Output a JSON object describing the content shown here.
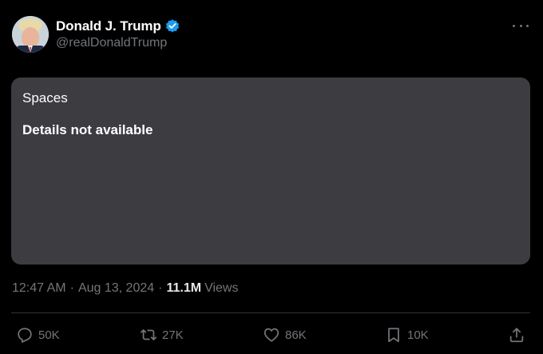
{
  "author": {
    "display_name": "Donald J. Trump",
    "handle": "@realDonaldTrump",
    "verified": true,
    "verified_color": "#1d9bf0"
  },
  "card": {
    "label": "Spaces",
    "details": "Details not available",
    "background": "#3d3c41"
  },
  "meta": {
    "time": "12:47 AM",
    "separator": "·",
    "date": "Aug 13, 2024",
    "views_count": "11.1M",
    "views_label": "Views"
  },
  "actions": {
    "replies": "50K",
    "reposts": "27K",
    "likes": "86K",
    "bookmarks": "10K"
  },
  "icons": {
    "more": "more-horizontal-icon",
    "reply": "reply-bubble-icon",
    "repost": "repost-arrows-icon",
    "like": "heart-icon",
    "bookmark": "bookmark-icon",
    "share": "share-upload-icon"
  }
}
